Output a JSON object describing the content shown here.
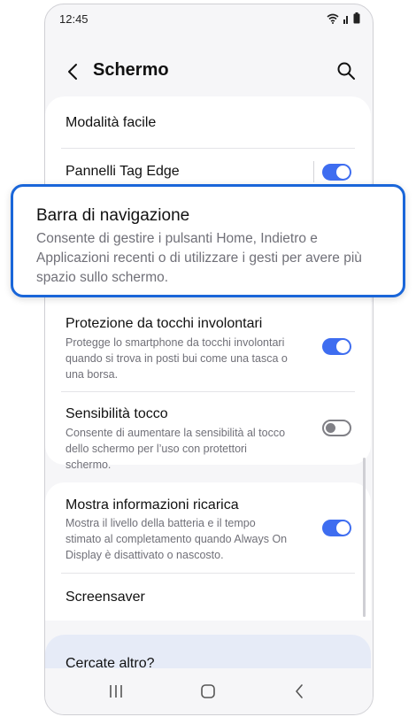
{
  "status_bar": {
    "time": "12:45"
  },
  "header": {
    "title": "Schermo"
  },
  "settings": {
    "easy_mode": "Modalità facile",
    "edge_panels": "Pannelli Tag Edge",
    "navigation_bar": {
      "title": "Barra di navigazione",
      "description": "Consente di gestire i pulsanti Home, Indietro e Applicazioni recenti o di utilizzare i gesti per avere più spazio sullo schermo."
    },
    "accidental_touch": {
      "title": "Protezione da tocchi involontari",
      "description": "Protegge lo smartphone da tocchi involontari quando si trova in posti bui come una tasca o una borsa.",
      "enabled": true
    },
    "touch_sensitivity": {
      "title": "Sensibilità tocco",
      "description": "Consente di aumentare la sensibilità al tocco dello schermo per l’uso con protettori schermo.",
      "enabled": false
    },
    "charging_info": {
      "title": "Mostra informazioni ricarica",
      "description": "Mostra il livello della batteria e il tempo stimato al completamento quando Always On Display è disattivato o nascosto.",
      "enabled": true
    },
    "screensaver": "Screensaver",
    "edge_panels_enabled": true
  },
  "footer": {
    "search_more": "Cercate altro?"
  },
  "colors": {
    "accent": "#3e6df0",
    "highlight_border": "#1a66d9"
  }
}
